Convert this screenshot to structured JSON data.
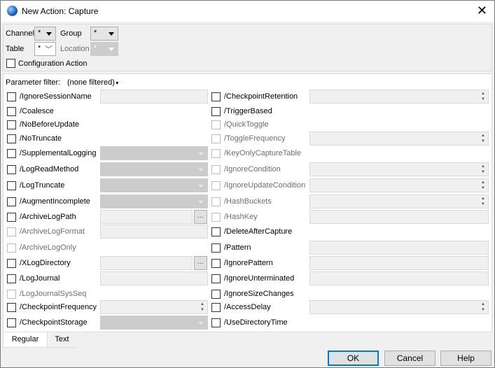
{
  "window": {
    "title": "New Action: Capture",
    "close_icon": "x-icon"
  },
  "header": {
    "channel": {
      "label": "Channel",
      "value": "*"
    },
    "group": {
      "label": "Group",
      "value": "*"
    },
    "table": {
      "label": "Table",
      "value": "*"
    },
    "location": {
      "label": "Location",
      "value": "*",
      "disabled": true
    },
    "configuration_action": {
      "label": "Configuration Action",
      "checked": false
    }
  },
  "filter": {
    "label": "Parameter filter:",
    "value": "(none filtered)"
  },
  "left_params": [
    {
      "name": "/IgnoreSessionName",
      "enabled": true,
      "control": "text"
    },
    {
      "name": "/Coalesce",
      "enabled": true,
      "control": "none"
    },
    {
      "name": "/NoBeforeUpdate",
      "enabled": true,
      "control": "none"
    },
    {
      "name": "/NoTruncate",
      "enabled": true,
      "control": "none"
    },
    {
      "name": "/SupplementalLogging",
      "enabled": true,
      "control": "combo"
    },
    {
      "name": "/LogReadMethod",
      "enabled": true,
      "control": "combo"
    },
    {
      "name": "/LogTruncate",
      "enabled": true,
      "control": "combo"
    },
    {
      "name": "/AugmentIncomplete",
      "enabled": true,
      "control": "combo"
    },
    {
      "name": "/ArchiveLogPath",
      "enabled": true,
      "control": "browse"
    },
    {
      "name": "/ArchiveLogFormat",
      "enabled": false,
      "control": "text"
    },
    {
      "name": "/ArchiveLogOnly",
      "enabled": false,
      "control": "none"
    },
    {
      "name": "/XLogDirectory",
      "enabled": true,
      "control": "browse"
    },
    {
      "name": "/LogJournal",
      "enabled": true,
      "control": "text"
    },
    {
      "name": "/LogJournalSysSeq",
      "enabled": false,
      "control": "none"
    },
    {
      "name": "/CheckpointFrequency",
      "enabled": true,
      "control": "spin"
    },
    {
      "name": "/CheckpointStorage",
      "enabled": true,
      "control": "combo"
    }
  ],
  "right_params": [
    {
      "name": "/CheckpointRetention",
      "enabled": true,
      "control": "spin"
    },
    {
      "name": "/TriggerBased",
      "enabled": true,
      "control": "none"
    },
    {
      "name": "/QuickToggle",
      "enabled": false,
      "control": "none"
    },
    {
      "name": "/ToggleFrequency",
      "enabled": false,
      "control": "spin"
    },
    {
      "name": "/KeyOnlyCaptureTable",
      "enabled": false,
      "control": "none"
    },
    {
      "name": "/IgnoreCondition",
      "enabled": false,
      "control": "spin"
    },
    {
      "name": "/IgnoreUpdateCondition",
      "enabled": false,
      "control": "spin"
    },
    {
      "name": "/HashBuckets",
      "enabled": false,
      "control": "spin"
    },
    {
      "name": "/HashKey",
      "enabled": false,
      "control": "text"
    },
    {
      "name": "/DeleteAfterCapture",
      "enabled": true,
      "control": "none"
    },
    {
      "name": "/Pattern",
      "enabled": true,
      "control": "text"
    },
    {
      "name": "/IgnorePattern",
      "enabled": true,
      "control": "text"
    },
    {
      "name": "/IgnoreUnterminated",
      "enabled": true,
      "control": "text"
    },
    {
      "name": "/IgnoreSizeChanges",
      "enabled": true,
      "control": "none"
    },
    {
      "name": "/AccessDelay",
      "enabled": true,
      "control": "spin"
    },
    {
      "name": "/UseDirectoryTime",
      "enabled": true,
      "control": "none"
    }
  ],
  "browse_label": "...",
  "tabs": [
    {
      "label": "Regular",
      "active": true
    },
    {
      "label": "Text",
      "active": false
    }
  ],
  "buttons": {
    "ok": "OK",
    "cancel": "Cancel",
    "help": "Help"
  }
}
